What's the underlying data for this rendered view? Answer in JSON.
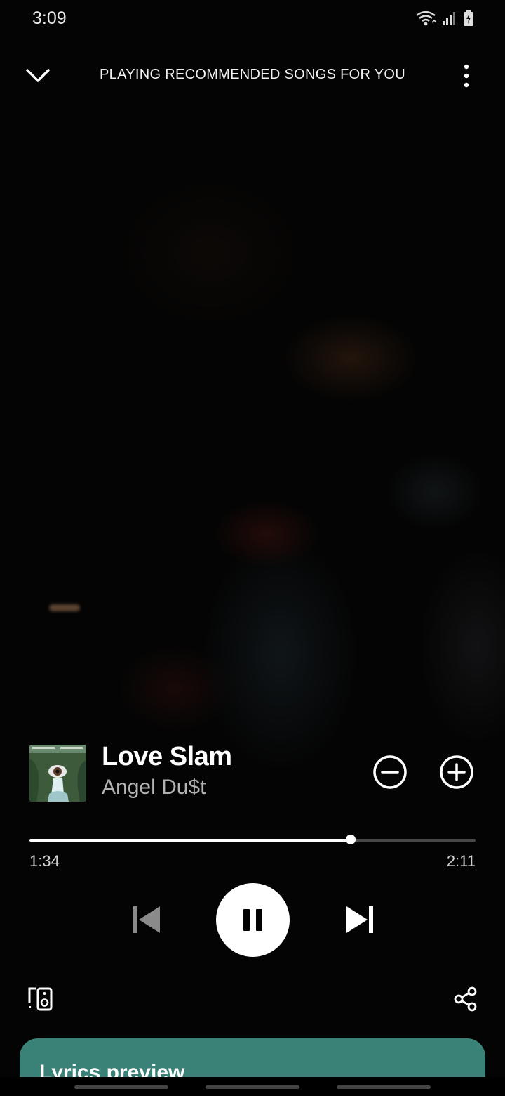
{
  "status_bar": {
    "time": "3:09",
    "icons": [
      "wifi-icon",
      "signal-icon",
      "battery-charging-icon"
    ]
  },
  "header": {
    "context_title": "PLAYING RECOMMENDED SONGS FOR YOU",
    "left_icon": "chevron-down-icon",
    "right_icon": "more-vertical-icon"
  },
  "track": {
    "title": "Love Slam",
    "artist": "Angel Du$t",
    "cover_icon": "album-cover-art"
  },
  "playback": {
    "elapsed": "1:34",
    "duration": "2:11",
    "progress": 0.72,
    "state": "playing"
  },
  "controls": {
    "icons": [
      "remove-circle-icon",
      "add-circle-icon",
      "skip-previous-icon",
      "pause-icon",
      "skip-next-icon",
      "devices-icon",
      "share-icon"
    ]
  },
  "lyrics": {
    "title": "Lyrics preview",
    "card_color": "#3a8278"
  },
  "colors": {
    "background": "#040404",
    "accent": "#ffffff",
    "secondary_text": "#b3b3b3"
  }
}
